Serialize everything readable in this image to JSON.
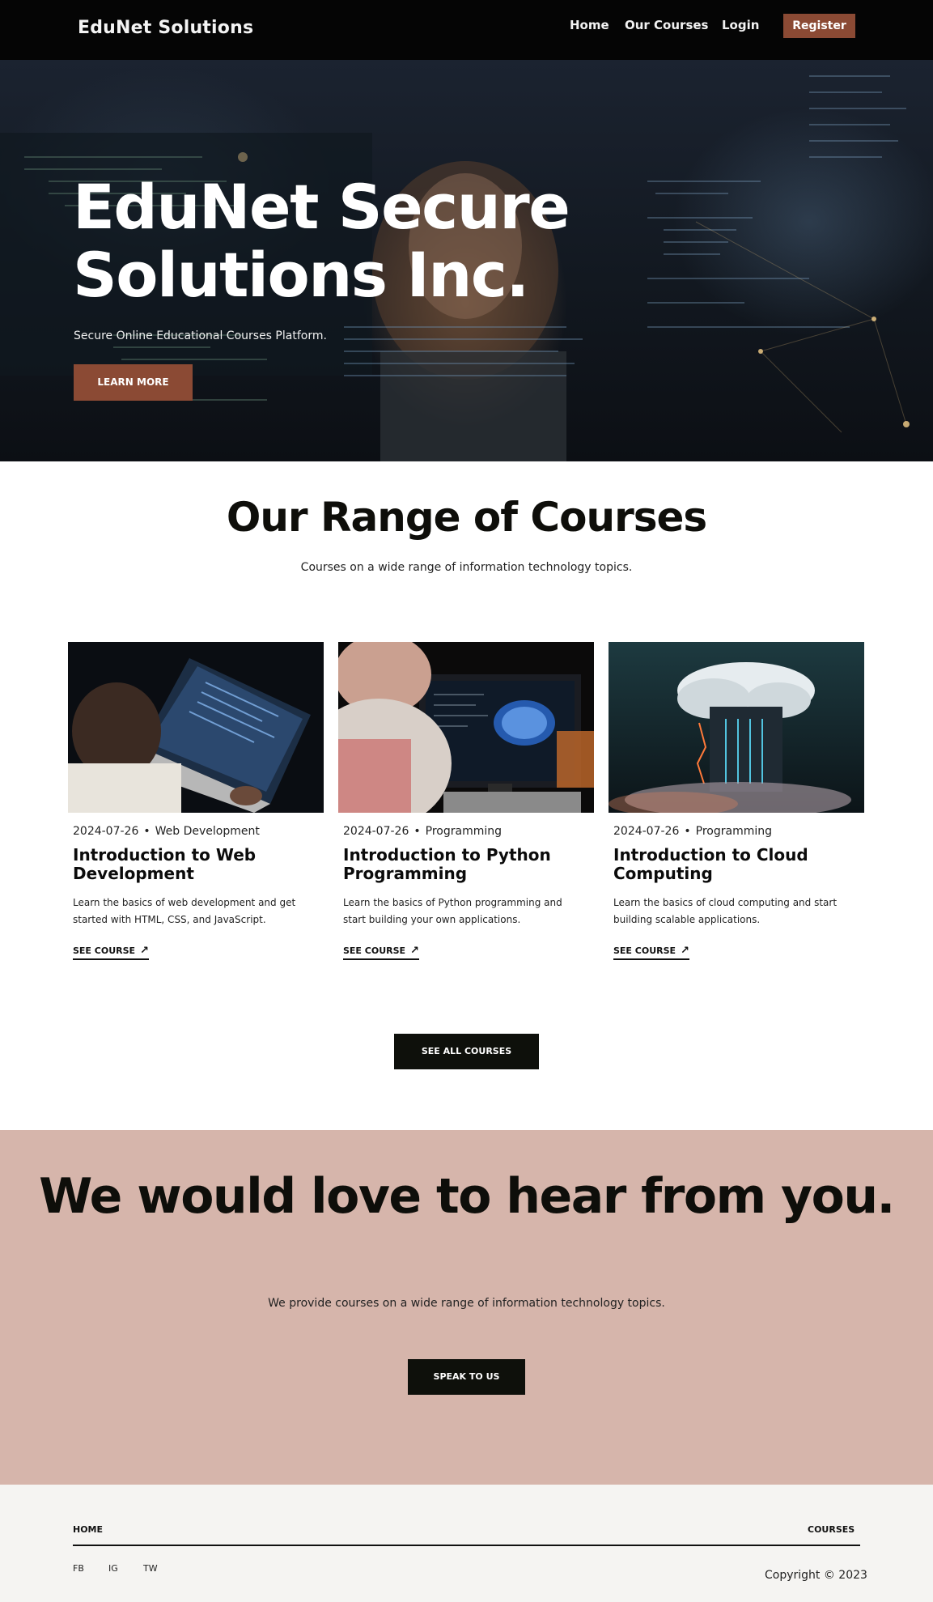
{
  "nav": {
    "brand": "EduNet Solutions",
    "links": [
      "Home",
      "Our Courses",
      "Login"
    ],
    "register": "Register"
  },
  "hero": {
    "title": "EduNet Secure Solutions Inc.",
    "subtitle": "Secure Online Educational Courses Platform.",
    "button": "LEARN MORE"
  },
  "courses": {
    "title": "Our Range of Courses",
    "subtitle": "Courses on a wide range of information technology topics.",
    "items": [
      {
        "date": "2024-07-26",
        "category": "Web Development",
        "title": "Introduction to Web Development",
        "description": "Learn the basics of web development and get started with HTML, CSS, and JavaScript.",
        "link": "SEE COURSE"
      },
      {
        "date": "2024-07-26",
        "category": "Programming",
        "title": "Introduction to Python Programming",
        "description": "Learn the basics of Python programming and start building your own applications.",
        "link": "SEE COURSE"
      },
      {
        "date": "2024-07-26",
        "category": "Programming",
        "title": "Introduction to Cloud Computing",
        "description": "Learn the basics of cloud computing and start building scalable applications.",
        "link": "SEE COURSE"
      }
    ],
    "all_button": "SEE ALL COURSES"
  },
  "contact": {
    "title": "We would love to hear from you.",
    "subtitle": "We provide courses on a wide range of information technology topics.",
    "button": "SPEAK TO US"
  },
  "footer": {
    "home": "HOME",
    "courses": "COURSES",
    "social": [
      "FB",
      "IG",
      "TW"
    ],
    "copyright": "Copyright © 2023"
  },
  "colors": {
    "nav_bg": "#050505",
    "accent": "#8b4a34",
    "contact_bg": "#d6b5ab",
    "dark_button": "#0e100b",
    "footer_bg": "#f5f4f2"
  },
  "icons": {
    "arrow": "arrow-up-right-icon"
  }
}
